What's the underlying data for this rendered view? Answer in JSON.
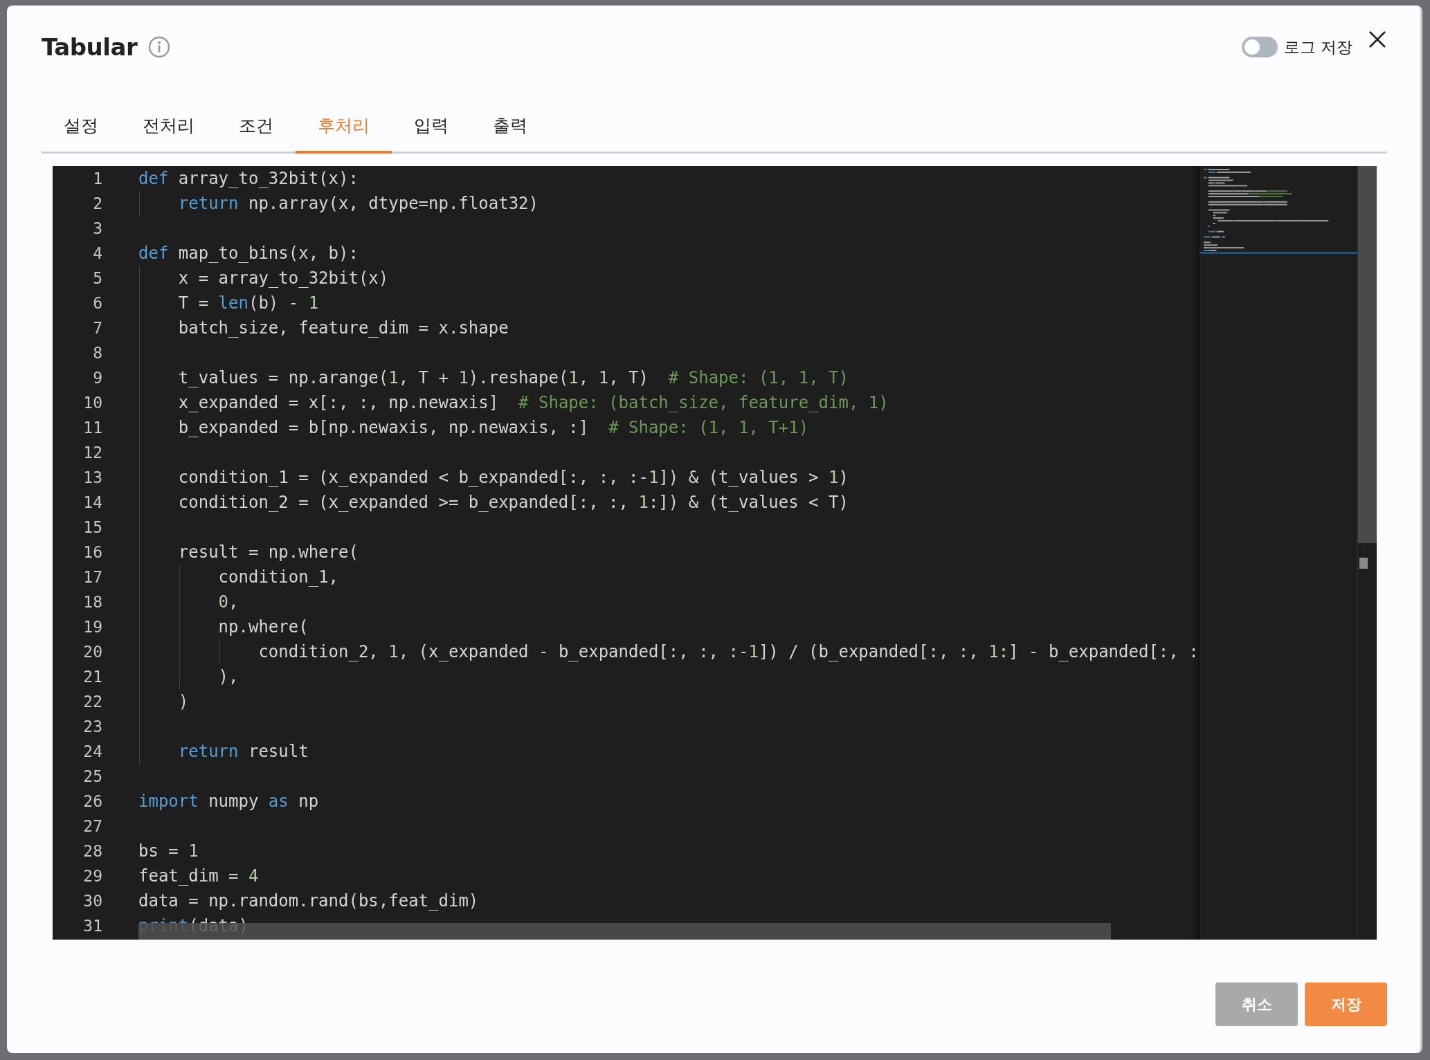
{
  "dialog": {
    "title": "Tabular"
  },
  "log_toggle": {
    "label": "로그 저장",
    "on": false
  },
  "tabs": [
    {
      "label": "설정",
      "selected": false
    },
    {
      "label": "전처리",
      "selected": false
    },
    {
      "label": "조건",
      "selected": false
    },
    {
      "label": "후처리",
      "selected": true
    },
    {
      "label": "입력",
      "selected": false
    },
    {
      "label": "출력",
      "selected": false
    }
  ],
  "editor": {
    "lines": [
      {
        "number": "1",
        "tokens": [
          {
            "kind": "keyword",
            "text": "def"
          },
          {
            "kind": "plain",
            "text": " array_to_32bit(x):"
          }
        ]
      },
      {
        "number": "2",
        "tokens": [
          {
            "kind": "keyword",
            "text": "    return"
          },
          {
            "kind": "plain",
            "text": " np.array(x, dtype=np.float32)"
          }
        ]
      },
      {
        "number": "3"
      },
      {
        "number": "4",
        "tokens": [
          {
            "kind": "keyword",
            "text": "def"
          },
          {
            "kind": "plain",
            "text": " map_to_bins(x, b):"
          }
        ]
      },
      {
        "number": "5",
        "tokens": [
          {
            "kind": "plain",
            "text": "    x = array_to_32bit(x)"
          }
        ]
      },
      {
        "number": "6",
        "tokens": [
          {
            "kind": "plain",
            "text": "    T = "
          },
          {
            "kind": "builtin",
            "text": "len"
          },
          {
            "kind": "plain",
            "text": "(b) - "
          },
          {
            "kind": "number",
            "text": "1"
          }
        ]
      },
      {
        "number": "7",
        "tokens": [
          {
            "kind": "plain",
            "text": "    batch_size, feature_dim = x.shape"
          }
        ]
      },
      {
        "number": "8"
      },
      {
        "number": "9",
        "tokens": [
          {
            "kind": "plain",
            "text": "    t_values = np.arange("
          },
          {
            "kind": "number",
            "text": "1"
          },
          {
            "kind": "plain",
            "text": ", T + "
          },
          {
            "kind": "number",
            "text": "1"
          },
          {
            "kind": "plain",
            "text": ").reshape("
          },
          {
            "kind": "number",
            "text": "1"
          },
          {
            "kind": "plain",
            "text": ", "
          },
          {
            "kind": "number",
            "text": "1"
          },
          {
            "kind": "plain",
            "text": ", T)  "
          },
          {
            "kind": "comment",
            "text": "# Shape: (1, 1, T)"
          }
        ]
      },
      {
        "number": "10",
        "tokens": [
          {
            "kind": "plain",
            "text": "    x_expanded = x[:, :, np.newaxis]  "
          },
          {
            "kind": "comment",
            "text": "# Shape: (batch_size, feature_dim, 1)"
          }
        ]
      },
      {
        "number": "11",
        "tokens": [
          {
            "kind": "plain",
            "text": "    b_expanded = b[np.newaxis, np.newaxis, :]  "
          },
          {
            "kind": "comment",
            "text": "# Shape: (1, 1, T+1)"
          }
        ]
      },
      {
        "number": "12"
      },
      {
        "number": "13",
        "tokens": [
          {
            "kind": "plain",
            "text": "    condition_1 = (x_expanded < b_expanded[:, :, :-"
          },
          {
            "kind": "number",
            "text": "1"
          },
          {
            "kind": "plain",
            "text": "]) & (t_values > "
          },
          {
            "kind": "number",
            "text": "1"
          },
          {
            "kind": "plain",
            "text": ")"
          }
        ]
      },
      {
        "number": "14",
        "tokens": [
          {
            "kind": "plain",
            "text": "    condition_2 = (x_expanded >= b_expanded[:, :, "
          },
          {
            "kind": "number",
            "text": "1"
          },
          {
            "kind": "plain",
            "text": ":]) & (t_values < T)"
          }
        ]
      },
      {
        "number": "15"
      },
      {
        "number": "16",
        "tokens": [
          {
            "kind": "plain",
            "text": "    result = np.where("
          }
        ]
      },
      {
        "number": "17",
        "tokens": [
          {
            "kind": "plain",
            "text": "        condition_1,"
          }
        ]
      },
      {
        "number": "18",
        "tokens": [
          {
            "kind": "number",
            "text": "        0"
          },
          {
            "kind": "plain",
            "text": ","
          }
        ]
      },
      {
        "number": "19",
        "tokens": [
          {
            "kind": "plain",
            "text": "        np.where("
          }
        ]
      },
      {
        "number": "20",
        "tokens": [
          {
            "kind": "plain",
            "text": "            condition_2, "
          },
          {
            "kind": "number",
            "text": "1"
          },
          {
            "kind": "plain",
            "text": ", (x_expanded - b_expanded[:, :, :-"
          },
          {
            "kind": "number",
            "text": "1"
          },
          {
            "kind": "plain",
            "text": "]) / (b_expanded[:, :, "
          },
          {
            "kind": "number",
            "text": "1"
          },
          {
            "kind": "plain",
            "text": ":] - b_expanded[:, :"
          }
        ]
      },
      {
        "number": "21",
        "tokens": [
          {
            "kind": "plain",
            "text": "        ),"
          }
        ]
      },
      {
        "number": "22",
        "tokens": [
          {
            "kind": "plain",
            "text": "    )"
          }
        ]
      },
      {
        "number": "23"
      },
      {
        "number": "24",
        "tokens": [
          {
            "kind": "keyword",
            "text": "    return"
          },
          {
            "kind": "plain",
            "text": " result"
          }
        ]
      },
      {
        "number": "25"
      },
      {
        "number": "26",
        "tokens": [
          {
            "kind": "keyword",
            "text": "import"
          },
          {
            "kind": "plain",
            "text": " numpy "
          },
          {
            "kind": "keyword",
            "text": "as"
          },
          {
            "kind": "plain",
            "text": " np"
          }
        ]
      },
      {
        "number": "27"
      },
      {
        "number": "28",
        "tokens": [
          {
            "kind": "plain",
            "text": "bs = "
          },
          {
            "kind": "number",
            "text": "1"
          }
        ]
      },
      {
        "number": "29",
        "tokens": [
          {
            "kind": "plain",
            "text": "feat_dim = "
          },
          {
            "kind": "number",
            "text": "4"
          }
        ]
      },
      {
        "number": "30",
        "tokens": [
          {
            "kind": "plain",
            "text": "data = np.random.rand(bs,feat_dim)"
          }
        ]
      },
      {
        "number": "31",
        "tokens": [
          {
            "kind": "builtin",
            "text": "print"
          },
          {
            "kind": "plain",
            "text": "(data)"
          }
        ]
      }
    ]
  },
  "buttons": [
    {
      "label": "취소",
      "kind": "secondary"
    },
    {
      "label": "저장",
      "kind": "primary"
    }
  ]
}
